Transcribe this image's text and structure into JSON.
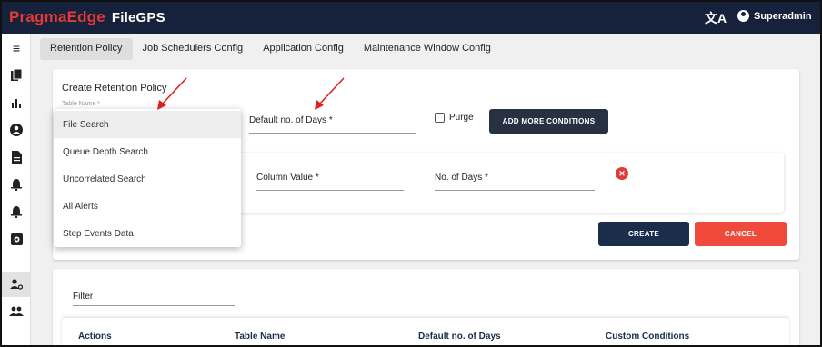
{
  "app": {
    "brand": "PragmaEdge",
    "product": "FileGPS",
    "translate_icon": "translate-icon",
    "user": "Superadmin"
  },
  "sidebar": {
    "items": [
      {
        "icon": "menu-icon",
        "glyph": "≡"
      },
      {
        "icon": "files-icon",
        "glyph": "▮"
      },
      {
        "icon": "bar-chart-icon",
        "glyph": "ıl"
      },
      {
        "icon": "account-circle-icon",
        "glyph": "●"
      },
      {
        "icon": "document-icon",
        "glyph": "▮"
      },
      {
        "icon": "bell-icon",
        "glyph": "▲"
      },
      {
        "icon": "alert-bell-icon",
        "glyph": "▲"
      },
      {
        "icon": "settings-icon",
        "glyph": "⚙"
      },
      {
        "icon": "user-settings-icon",
        "glyph": "♟",
        "active": true
      },
      {
        "icon": "group-icon",
        "glyph": "♟♟"
      }
    ]
  },
  "tabs": [
    {
      "label": "Retention Policy",
      "active": true
    },
    {
      "label": "Job Schedulers Config"
    },
    {
      "label": "Application Config"
    },
    {
      "label": "Maintenance Window Config"
    }
  ],
  "form": {
    "title": "Create Retention Policy",
    "table_name_label": "Table Name *",
    "default_days_label": "Default no. of Days *",
    "purge_label": "Purge",
    "add_conditions_label": "ADD MORE CONDITIONS",
    "column_value_label": "Column Value *",
    "no_of_days_label": "No. of Days *",
    "create_label": "CREATE",
    "cancel_label": "CANCEL"
  },
  "dropdown": {
    "options": [
      "File Search",
      "Queue Depth Search",
      "Uncorrelated Search",
      "All Alerts",
      "Step Events Data"
    ],
    "highlighted": "File Search"
  },
  "list": {
    "filter_label": "Filter",
    "columns": [
      "Actions",
      "Table Name",
      "Default no. of Days",
      "Custom Conditions"
    ]
  },
  "colors": {
    "topbar": "#16213b",
    "brand_red": "#e53935",
    "create_button": "#1b2d4b",
    "cancel_button": "#ef4a3c",
    "annotation_arrow": "#e02020"
  }
}
